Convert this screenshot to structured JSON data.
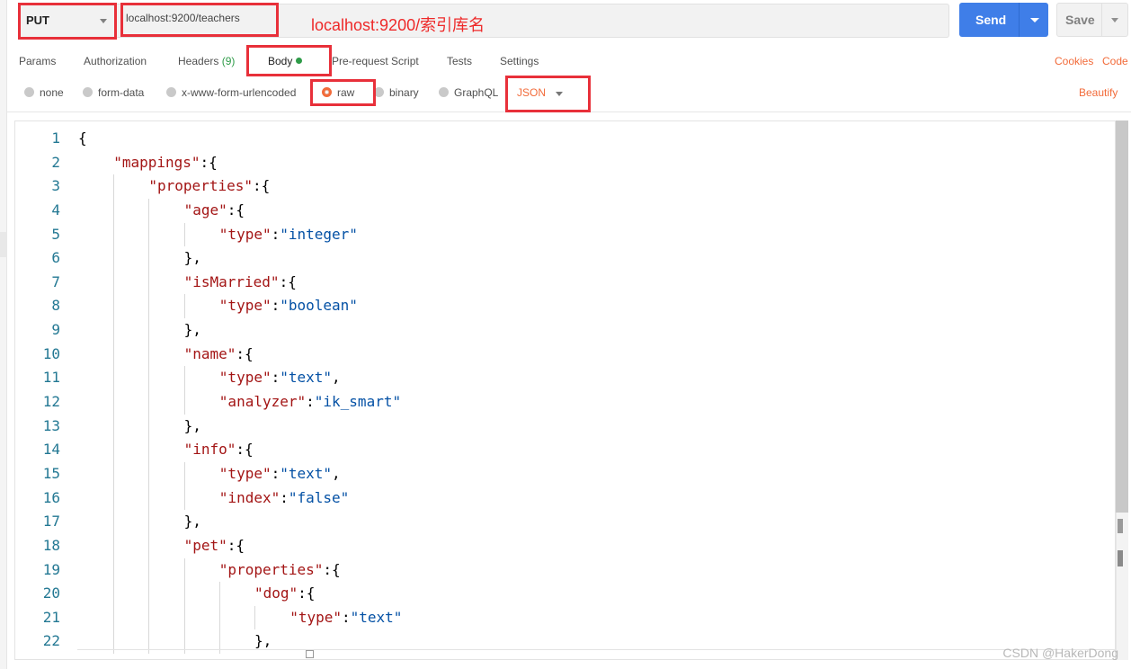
{
  "request": {
    "method": "PUT",
    "url": "localhost:9200/teachers",
    "send_label": "Send",
    "save_label": "Save"
  },
  "annotation": "localhost:9200/索引库名",
  "tabs": [
    {
      "label": "Params"
    },
    {
      "label": "Authorization"
    },
    {
      "label": "Headers",
      "count": "(9)"
    },
    {
      "label": "Body"
    },
    {
      "label": "Pre-request Script"
    },
    {
      "label": "Tests"
    },
    {
      "label": "Settings"
    }
  ],
  "right_links": {
    "cookies": "Cookies",
    "code": "Code",
    "beautify": "Beautify"
  },
  "body_types": [
    {
      "label": "none",
      "selected": false
    },
    {
      "label": "form-data",
      "selected": false
    },
    {
      "label": "x-www-form-urlencoded",
      "selected": false
    },
    {
      "label": "raw",
      "selected": true
    },
    {
      "label": "binary",
      "selected": false
    },
    {
      "label": "GraphQL",
      "selected": false
    }
  ],
  "raw_format": "JSON",
  "editor": {
    "line_numbers": [
      "1",
      "2",
      "3",
      "4",
      "5",
      "6",
      "7",
      "8",
      "9",
      "10",
      "11",
      "12",
      "13",
      "14",
      "15",
      "16",
      "17",
      "18",
      "19",
      "20",
      "21",
      "22"
    ],
    "lines": [
      [
        {
          "t": "p",
          "v": "{"
        }
      ],
      [
        {
          "t": "k",
          "v": "\"mappings\""
        },
        {
          "t": "p",
          "v": ":{"
        }
      ],
      [
        {
          "t": "k",
          "v": "\"properties\""
        },
        {
          "t": "p",
          "v": ":{"
        }
      ],
      [
        {
          "t": "k",
          "v": "\"age\""
        },
        {
          "t": "p",
          "v": ":{"
        }
      ],
      [
        {
          "t": "k",
          "v": "\"type\""
        },
        {
          "t": "p",
          "v": ":"
        },
        {
          "t": "s",
          "v": "\"integer\""
        }
      ],
      [
        {
          "t": "p",
          "v": "},"
        }
      ],
      [
        {
          "t": "k",
          "v": "\"isMarried\""
        },
        {
          "t": "p",
          "v": ":{"
        }
      ],
      [
        {
          "t": "k",
          "v": "\"type\""
        },
        {
          "t": "p",
          "v": ":"
        },
        {
          "t": "s",
          "v": "\"boolean\""
        }
      ],
      [
        {
          "t": "p",
          "v": "},"
        }
      ],
      [
        {
          "t": "k",
          "v": "\"name\""
        },
        {
          "t": "p",
          "v": ":{"
        }
      ],
      [
        {
          "t": "k",
          "v": "\"type\""
        },
        {
          "t": "p",
          "v": ":"
        },
        {
          "t": "s",
          "v": "\"text\""
        },
        {
          "t": "p",
          "v": ","
        }
      ],
      [
        {
          "t": "k",
          "v": "\"analyzer\""
        },
        {
          "t": "p",
          "v": ":"
        },
        {
          "t": "s",
          "v": "\"ik_smart\""
        }
      ],
      [
        {
          "t": "p",
          "v": "},"
        }
      ],
      [
        {
          "t": "k",
          "v": "\"info\""
        },
        {
          "t": "p",
          "v": ":{"
        }
      ],
      [
        {
          "t": "k",
          "v": "\"type\""
        },
        {
          "t": "p",
          "v": ":"
        },
        {
          "t": "s",
          "v": "\"text\""
        },
        {
          "t": "p",
          "v": ","
        }
      ],
      [
        {
          "t": "k",
          "v": "\"index\""
        },
        {
          "t": "p",
          "v": ":"
        },
        {
          "t": "s",
          "v": "\"false\""
        }
      ],
      [
        {
          "t": "p",
          "v": "},"
        }
      ],
      [
        {
          "t": "k",
          "v": "\"pet\""
        },
        {
          "t": "p",
          "v": ":{"
        }
      ],
      [
        {
          "t": "k",
          "v": "\"properties\""
        },
        {
          "t": "p",
          "v": ":{"
        }
      ],
      [
        {
          "t": "k",
          "v": "\"dog\""
        },
        {
          "t": "p",
          "v": ":{"
        }
      ],
      [
        {
          "t": "k",
          "v": "\"type\""
        },
        {
          "t": "p",
          "v": ":"
        },
        {
          "t": "s",
          "v": "\"text\""
        }
      ],
      [
        {
          "t": "p",
          "v": "},"
        }
      ]
    ]
  },
  "watermark": "CSDN @HakerDong"
}
